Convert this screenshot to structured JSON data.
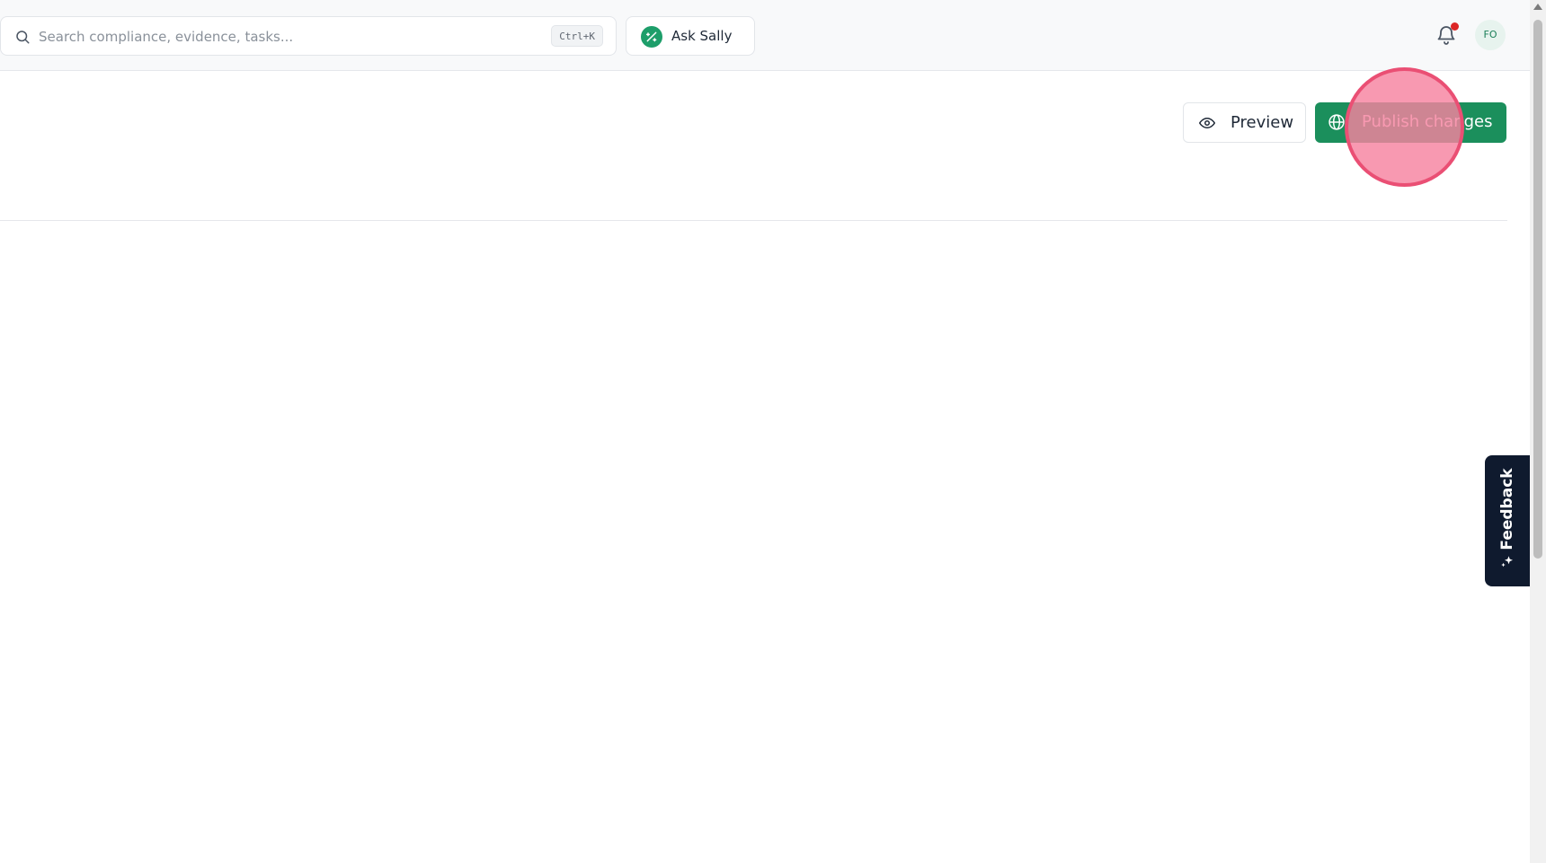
{
  "search": {
    "placeholder": "Search compliance, evidence, tasks...",
    "shortcut": "Ctrl+K",
    "icon": "search-icon"
  },
  "assistant": {
    "label": "Ask Sally",
    "icon": "magic-wand-icon"
  },
  "header": {
    "notifications_icon": "bell-icon",
    "has_unread": true,
    "avatar_initials": "FO"
  },
  "actions": {
    "preview_label": "Preview",
    "publish_label": "Publish changes"
  },
  "feedback": {
    "label": "Feedback",
    "icon": "sparkle-icon"
  },
  "colors": {
    "primary": "#1b8f5c",
    "feedback_bg": "#0f1a2e",
    "notification_dot": "#dc2626",
    "click_marker": "#ea4f74"
  }
}
